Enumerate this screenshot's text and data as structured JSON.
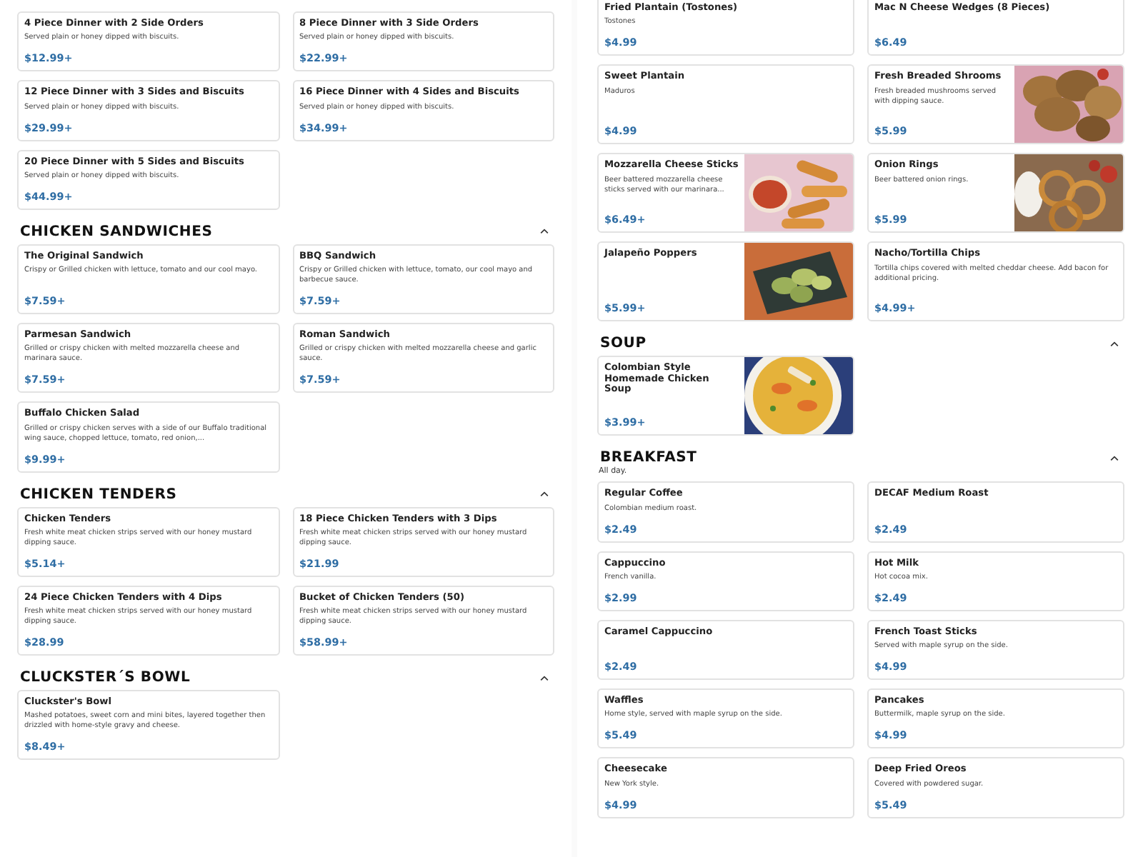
{
  "left_column": [
    {
      "items": [
        {
          "name": "4 Piece Dinner with 2 Side Orders",
          "description": "Served plain or honey dipped with biscuits.",
          "price": "$12.99+"
        },
        {
          "name": "8 Piece Dinner with 3 Side Orders",
          "description": "Served plain or honey dipped with biscuits.",
          "price": "$22.99+"
        },
        {
          "name": "12 Piece Dinner with 3 Sides and Biscuits",
          "description": "Served plain or honey dipped with biscuits.",
          "price": "$29.99+"
        },
        {
          "name": "16 Piece Dinner with 4 Sides and Biscuits",
          "description": "Served plain or honey dipped with biscuits.",
          "price": "$34.99+"
        },
        {
          "name": "20 Piece Dinner with 5 Sides and Biscuits",
          "description": "Served plain or honey dipped with biscuits.",
          "price": "$44.99+"
        }
      ]
    },
    {
      "title": "CHICKEN SANDWICHES",
      "items": [
        {
          "name": "The Original Sandwich",
          "description": "Crispy or Grilled chicken with lettuce, tomato and our cool mayo.",
          "price": "$7.59+"
        },
        {
          "name": "BBQ Sandwich",
          "description": "Crispy or Grilled chicken with lettuce, tomato, our cool mayo and barbecue sauce.",
          "price": "$7.59+"
        },
        {
          "name": "Parmesan Sandwich",
          "description": "Grilled or crispy chicken with melted mozzarella cheese and marinara sauce.",
          "price": "$7.59+"
        },
        {
          "name": "Roman Sandwich",
          "description": "Grilled or crispy chicken with melted mozzarella cheese and garlic sauce.",
          "price": "$7.59+"
        },
        {
          "name": "Buffalo Chicken Salad",
          "description": "Grilled or crispy chicken serves with a side of our Buffalo traditional wing sauce, chopped lettuce, tomato, red onion,...",
          "price": "$9.99+"
        }
      ]
    },
    {
      "title": "CHICKEN TENDERS",
      "items": [
        {
          "name": "Chicken Tenders",
          "description": "Fresh white meat chicken strips served with our honey mustard dipping sauce.",
          "price": "$5.14+"
        },
        {
          "name": "18 Piece Chicken Tenders with 3 Dips",
          "description": "Fresh white meat chicken strips served with our honey mustard dipping sauce.",
          "price": "$21.99"
        },
        {
          "name": "24 Piece Chicken Tenders with 4 Dips",
          "description": "Fresh white meat chicken strips served with our honey mustard dipping sauce.",
          "price": "$28.99"
        },
        {
          "name": "Bucket of Chicken Tenders (50)",
          "description": "Fresh white meat chicken strips served with our honey mustard dipping sauce.",
          "price": "$58.99+"
        }
      ]
    },
    {
      "title": "CLUCKSTER´S BOWL",
      "items": [
        {
          "name": "Cluckster's Bowl",
          "description": "Mashed potatoes, sweet corn and mini bites, layered together then drizzled with home-style gravy and cheese.",
          "price": "$8.49+"
        }
      ]
    }
  ],
  "right_column": [
    {
      "items": [
        {
          "name": "Fried Plantain (Tostones)",
          "description": "Tostones",
          "price": "$4.99"
        },
        {
          "name": "Mac N Cheese Wedges (8 Pieces)",
          "price": "$6.49"
        },
        {
          "name": "Sweet Plantain",
          "description": "Maduros",
          "price": "$4.99"
        },
        {
          "name": "Fresh Breaded Shrooms",
          "description": "Fresh breaded mushrooms served with dipping sauce.",
          "price": "$5.99",
          "photo": true
        },
        {
          "name": "Mozzarella Cheese Sticks",
          "description": "Beer battered mozzarella cheese sticks served with our marinara...",
          "price": "$6.49+",
          "photo": true
        },
        {
          "name": "Onion Rings",
          "description": "Beer battered onion rings.",
          "price": "$5.99",
          "photo": true
        },
        {
          "name": "Jalapeño Poppers",
          "price": "$5.99+",
          "photo": true
        },
        {
          "name": "Nacho/Tortilla Chips",
          "description": "Tortilla chips covered with melted cheddar cheese. Add bacon for additional pricing.",
          "price": "$4.99+"
        }
      ]
    },
    {
      "title": "SOUP",
      "items": [
        {
          "name": "Colombian Style Homemade Chicken Soup",
          "price": "$3.99+",
          "photo": true
        }
      ]
    },
    {
      "title": "BREAKFAST",
      "subtitle": "All day.",
      "items": [
        {
          "name": "Regular Coffee",
          "description": "Colombian medium roast.",
          "price": "$2.49"
        },
        {
          "name": "DECAF Medium Roast",
          "price": "$2.49"
        },
        {
          "name": "Cappuccino",
          "description": "French vanilla.",
          "price": "$2.99"
        },
        {
          "name": "Hot Milk",
          "description": "Hot cocoa mix.",
          "price": "$2.49"
        },
        {
          "name": "Caramel Cappuccino",
          "price": "$2.49"
        },
        {
          "name": "French Toast Sticks",
          "description": "Served with maple syrup on the side.",
          "price": "$4.99"
        },
        {
          "name": "Waffles",
          "description": "Home style, served with maple syrup on the side.",
          "price": "$5.49"
        },
        {
          "name": "Pancakes",
          "description": "Buttermilk, maple syrup on the side.",
          "price": "$4.99"
        },
        {
          "name": "Cheesecake",
          "description": "New York style.",
          "price": "$4.99"
        },
        {
          "name": "Deep Fried Oreos",
          "description": "Covered with powdered sugar.",
          "price": "$5.49"
        }
      ]
    }
  ]
}
